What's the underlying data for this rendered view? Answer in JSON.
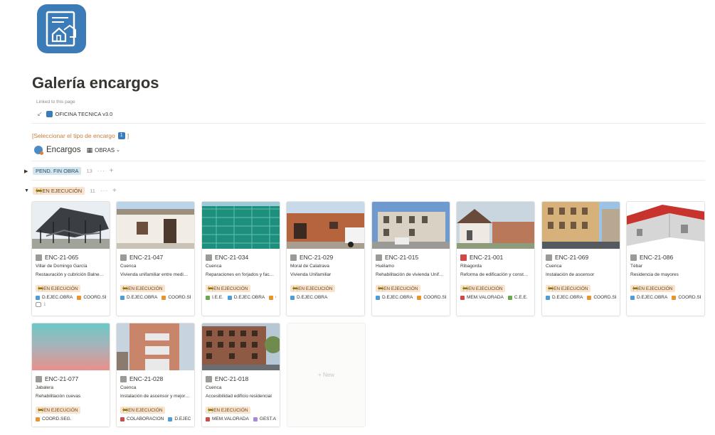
{
  "page": {
    "title": "Galería encargos",
    "linked_label": "Linked to this page",
    "linked_page": "OFICINA TECNICA v3.0",
    "select_prompt": "[Seleccionar el tipo de encargo",
    "select_num": "1",
    "select_close": "]"
  },
  "database": {
    "title": "Encargos",
    "view": "OBRAS"
  },
  "groups": [
    {
      "label": "PEND. FIN OBRA",
      "count": "13",
      "collapsed": true,
      "color": "#d3e5ef"
    },
    {
      "label": "EN EJECUCIÓN",
      "count": "11",
      "collapsed": false,
      "color": "#f8e3cc"
    }
  ],
  "colors": {
    "D.EJEC.OBRA": "#4d9ed6",
    "COORD.SEG.": "#e8932e",
    "I.E.E.": "#6aa84f",
    "MEM.VALORADA": "#d04848",
    "C.E.E.": "#6aa84f",
    "COLABORACIÓN": "#d04848",
    "GEST.AY": "#a78bd4"
  },
  "cards": [
    {
      "id": "ENC-21-065",
      "location": "Villar de Domingo García",
      "description": "Restauración y cubrición Balne…",
      "status": "EN EJECUCIÓN",
      "tags": [
        "D.EJEC.OBRA",
        "COORD.SEG."
      ],
      "comments": "1",
      "icon": "doc-icon"
    },
    {
      "id": "ENC-21-047",
      "location": "Cuenca",
      "description": "Vivienda unifamiliar entre medi…",
      "status": "EN EJECUCIÓN",
      "tags": [
        "D.EJEC.OBRA",
        "COORD.SEG."
      ],
      "icon": "doc-icon"
    },
    {
      "id": "ENC-21-034",
      "location": "Cuenca",
      "description": "Reparaciones en forjados y fac…",
      "status": "EN EJECUCIÓN",
      "tags": [
        "I.E.E.",
        "D.EJEC.OBRA",
        "CO"
      ],
      "icon": "doc-icon"
    },
    {
      "id": "ENC-21-029",
      "location": "Moral de Calatrava",
      "description": "Vivienda Unifamiliar",
      "status": "EN EJECUCIÓN",
      "tags": [
        "D.EJEC.OBRA"
      ],
      "icon": "doc-icon"
    },
    {
      "id": "ENC-21-015",
      "location": "Huélamo",
      "description": "Rehabilitación de vivienda Unif…",
      "status": "EN EJECUCIÓN",
      "tags": [
        "D.EJEC.OBRA",
        "COORD.SEG."
      ],
      "icon": "doc-icon"
    },
    {
      "id": "ENC-21-001",
      "location": "Ribagorda",
      "description": "Reforma de edificación y const…",
      "status": "EN EJECUCIÓN",
      "tags": [
        "MEM.VALORADA",
        "C.E.E."
      ],
      "icon": "tool-icon"
    },
    {
      "id": "ENC-21-069",
      "location": "Cuenca",
      "description": "Instalación de ascensor",
      "status": "EN EJECUCIÓN",
      "tags": [
        "D.EJEC.OBRA",
        "COORD.SEG."
      ],
      "icon": "doc-icon"
    },
    {
      "id": "ENC-21-086",
      "location": "Tébar",
      "description": "Residencia de mayores",
      "status": "EN EJECUCIÓN",
      "tags": [
        "D.EJEC.OBRA",
        "COORD.SEG."
      ],
      "icon": "doc-icon"
    },
    {
      "id": "ENC-21-077",
      "location": "Jabalera",
      "description": "Rehabilitación cuevas",
      "status": "EN EJECUCIÓN",
      "tags": [
        "COORD.SEG."
      ],
      "icon": "doc-icon"
    },
    {
      "id": "ENC-21-028",
      "location": "Cuenca",
      "description": "Instalación de ascensor y mejor…",
      "status": "EN EJECUCIÓN",
      "tags": [
        "COLABORACIÓN",
        "D.EJEC.O"
      ],
      "icon": "doc-icon"
    },
    {
      "id": "ENC-21-018",
      "location": "Cuenca",
      "description": "Accesibilidad edificio residencial",
      "status": "EN EJECUCIÓN",
      "tags": [
        "MEM.VALORADA",
        "GEST.AY"
      ],
      "icon": "doc-icon"
    }
  ],
  "new_label": "+ New"
}
